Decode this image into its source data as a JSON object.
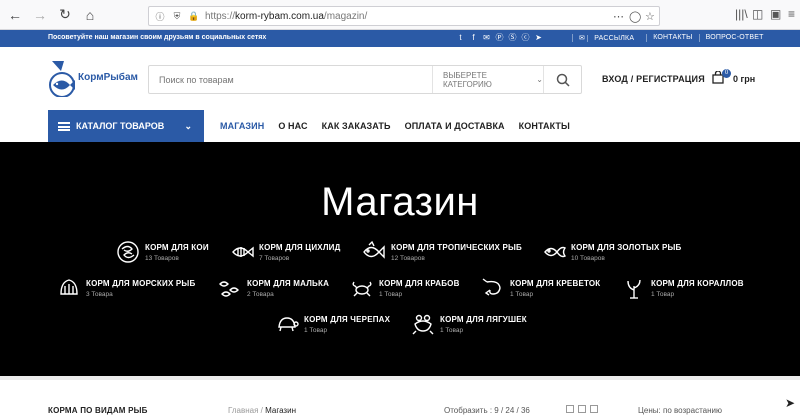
{
  "browser": {
    "url_prefix": "https://",
    "url_domain": "korm-rybam.com.ua",
    "url_path": "/magazin/"
  },
  "topbar": {
    "promo": "Посоветуйте наш магазин своим друзьям в социальных сетях",
    "social_icons": [
      "twitter-icon",
      "facebook-icon",
      "email-icon",
      "pinterest-icon",
      "skype-icon",
      "vk-icon",
      "telegram-icon"
    ],
    "links": [
      "РАССЫЛКА",
      "КОНТАКТЫ",
      "ВОПРОС-ОТВЕТ"
    ]
  },
  "header": {
    "logo_text": "КормРыбам",
    "search_placeholder": "Поиск по товарам",
    "category_select": "ВЫБЕРЕТЕ КАТЕГОРИЮ",
    "login": "ВХОД / РЕГИСТРАЦИЯ",
    "cart_count": "0",
    "cart_total": "0 грн"
  },
  "nav": {
    "catalog": "КАТАЛОГ ТОВАРОВ",
    "items": [
      "МАГАЗИН",
      "О НАС",
      "КАК ЗАКАЗАТЬ",
      "ОПЛАТА И ДОСТАВКА",
      "КОНТАКТЫ"
    ]
  },
  "hero": {
    "title": "Магазин",
    "categories": [
      {
        "name": "КОРМ ДЛЯ КОИ",
        "count": "13 Товаров",
        "icon": "koi-icon"
      },
      {
        "name": "КОРМ ДЛЯ ЦИХЛИД",
        "count": "7 Товаров",
        "icon": "cichlid-icon"
      },
      {
        "name": "КОРМ ДЛЯ ТРОПИЧЕСКИХ РЫБ",
        "count": "12 Товаров",
        "icon": "tropical-fish-icon"
      },
      {
        "name": "КОРМ ДЛЯ ЗОЛОТЫХ РЫБ",
        "count": "10 Товаров",
        "icon": "goldfish-icon"
      },
      {
        "name": "КОРМ ДЛЯ МОРСКИХ РЫБ",
        "count": "3 Товара",
        "icon": "marine-fish-icon"
      },
      {
        "name": "КОРМ ДЛЯ МАЛЬКА",
        "count": "2 Товара",
        "icon": "fry-icon"
      },
      {
        "name": "КОРМ ДЛЯ КРАБОВ",
        "count": "1 Товар",
        "icon": "crab-icon"
      },
      {
        "name": "КОРМ ДЛЯ КРЕВЕТОК",
        "count": "1 Товар",
        "icon": "shrimp-icon"
      },
      {
        "name": "КОРМ ДЛЯ КОРАЛЛОВ",
        "count": "1 Товар",
        "icon": "coral-icon"
      },
      {
        "name": "КОРМ ДЛЯ ЧЕРЕПАХ",
        "count": "1 Товар",
        "icon": "turtle-icon"
      },
      {
        "name": "КОРМ ДЛЯ ЛЯГУШЕК",
        "count": "1 Товар",
        "icon": "frog-icon"
      }
    ]
  },
  "listing": {
    "sidebar_title": "КОРМА ПО ВИДАМ РЫБ",
    "breadcrumb_home": "Главная",
    "breadcrumb_current": "Магазин",
    "show_label": "Отобразить :",
    "show_options": "9 / 24 / 36",
    "sort": "Цены: по возрастанию"
  },
  "colors": {
    "brand": "#2b5aa6",
    "hero_bg": "#000000"
  }
}
